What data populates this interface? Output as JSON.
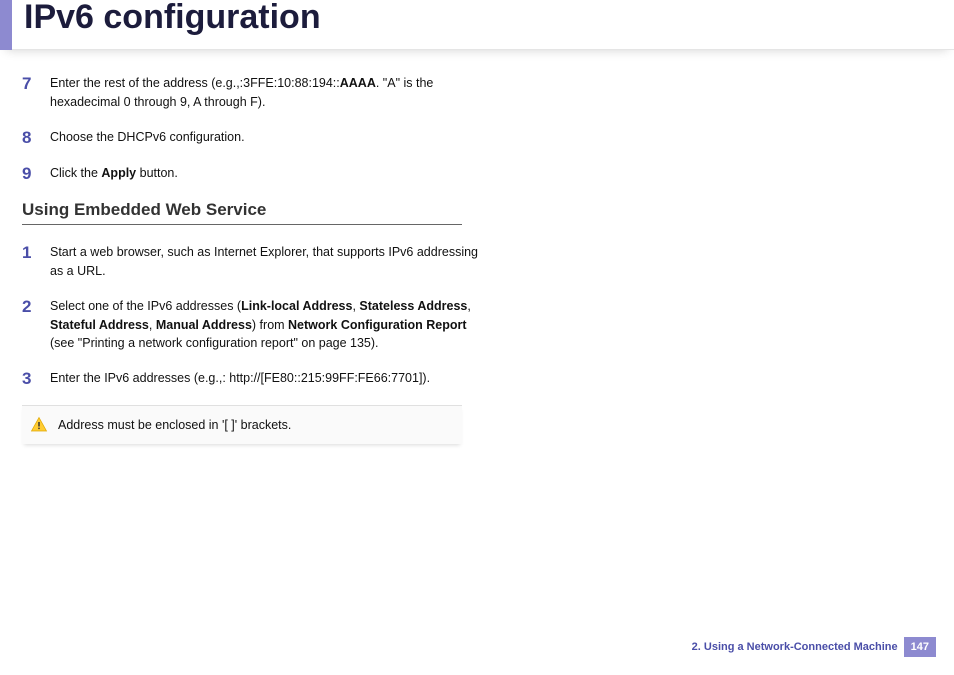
{
  "title": "IPv6 configuration",
  "steps_top": [
    {
      "num": "7",
      "html": "Enter the rest of the address (e.g.,:3FFE:10:88:194::<b>AAAA</b>. \"A\" is the hexadecimal 0 through 9, A through F)."
    },
    {
      "num": "8",
      "html": "Choose the DHCPv6 configuration."
    },
    {
      "num": "9",
      "html": "Click the <b>Apply</b> button."
    }
  ],
  "subhead": "Using Embedded Web Service",
  "steps_bottom": [
    {
      "num": "1",
      "html": "Start a web browser, such as Internet Explorer, that supports IPv6 addressing as a URL."
    },
    {
      "num": "2",
      "html": "Select one of the IPv6 addresses (<b>Link-local Address</b>, <b>Stateless Address</b>, <b>Stateful Address</b>, <b>Manual Address</b>) from <b>Network Configuration Report</b> (see \"Printing a network configuration report\" on page 135)."
    },
    {
      "num": "3",
      "html": "Enter the IPv6 addresses (e.g.,: http://[FE80::215:99FF:FE66:7701])."
    }
  ],
  "note": "Address must be enclosed in '[ ]' brackets.",
  "footer_chapter": "2.  Using a Network-Connected Machine",
  "footer_page": "147"
}
